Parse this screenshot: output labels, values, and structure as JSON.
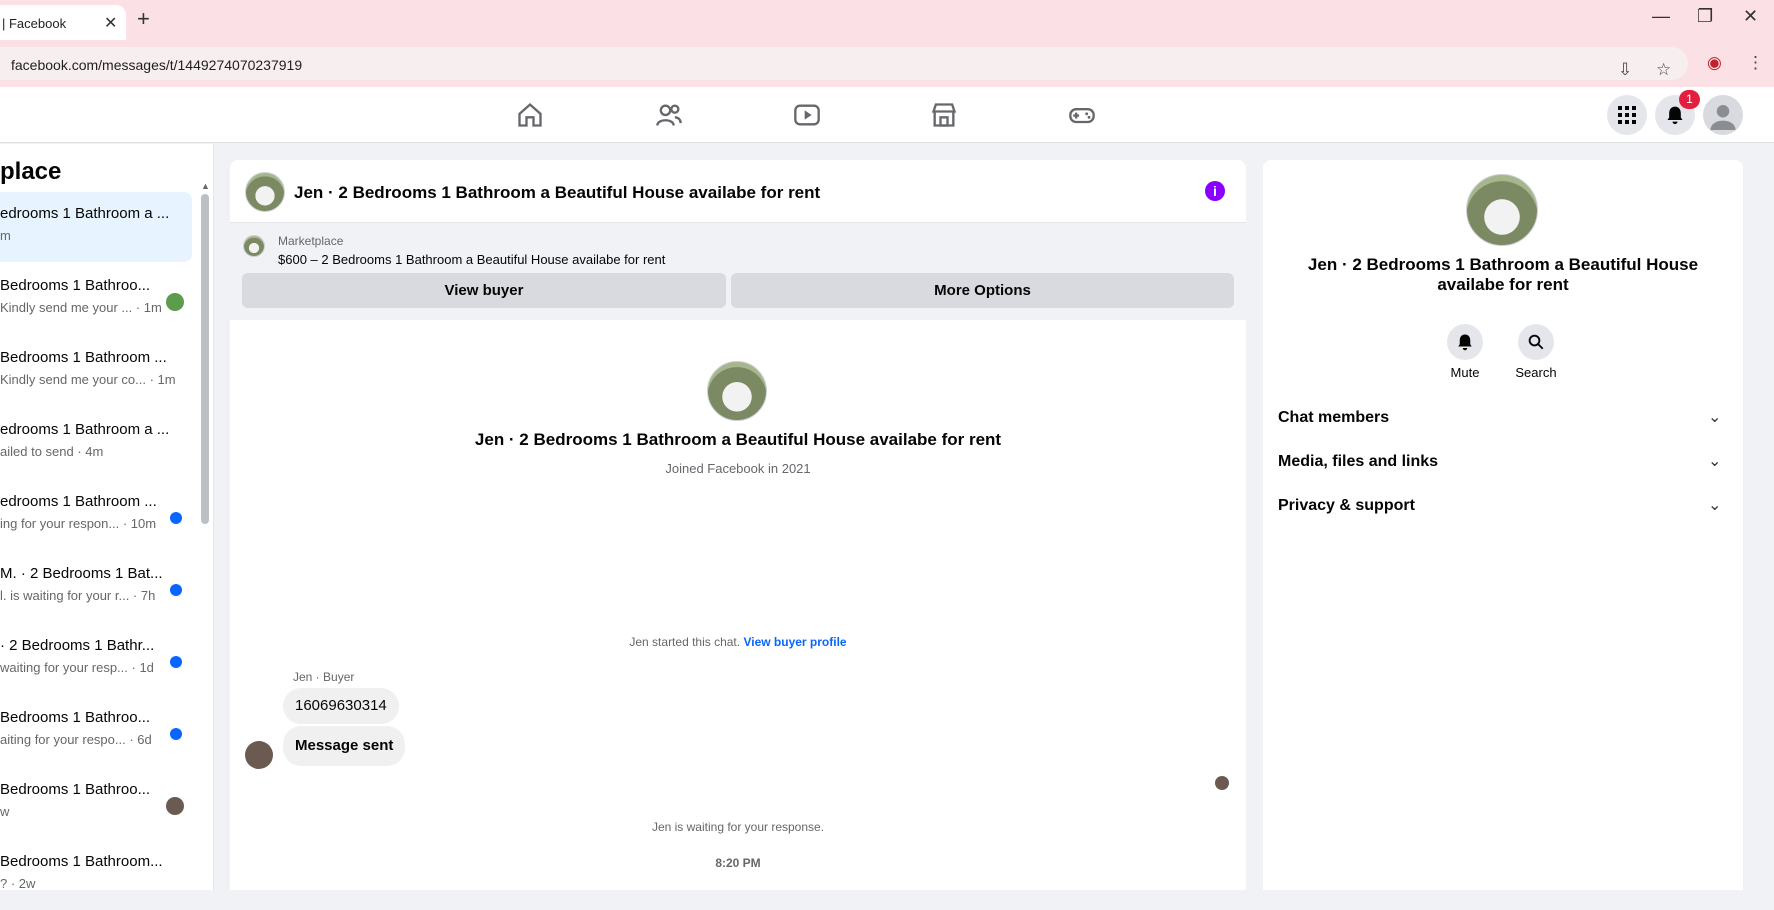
{
  "browser": {
    "tab_title": "| Facebook",
    "tab_close": "✕",
    "new_tab": "+",
    "url": "facebook.com/messages/t/1449274070237919"
  },
  "top_nav": {
    "notification_count": "1"
  },
  "left_panel": {
    "title": "place",
    "conversations": [
      {
        "name": "edrooms 1 Bathroom a ...",
        "sub": "m",
        "active": true
      },
      {
        "name": " Bedrooms 1 Bathroo...",
        "sub": "Kindly send me your ... · 1m"
      },
      {
        "name": " Bedrooms 1 Bathroom ...",
        "sub": "Kindly send me your co... · 1m"
      },
      {
        "name": "edrooms 1 Bathroom a ...",
        "sub": "ailed to send · 4m"
      },
      {
        "name": "edrooms 1 Bathroom ...",
        "sub": "ing for your respon... · 10m"
      },
      {
        "name": "M. · 2 Bedrooms 1 Bat...",
        "sub": "l. is waiting for your r... · 7h"
      },
      {
        "name": "· 2 Bedrooms 1 Bathr...",
        "sub": "waiting for your resp... · 1d"
      },
      {
        "name": "Bedrooms 1 Bathroo...",
        "sub": "aiting for your respo... · 6d"
      },
      {
        "name": "Bedrooms 1 Bathroo...",
        "sub": "w"
      },
      {
        "name": " Bedrooms 1 Bathroom...",
        "sub": "? · 2w"
      }
    ]
  },
  "chat": {
    "title": "Jen · 2 Bedrooms 1 Bathroom a Beautiful House availabe for rent",
    "info_icon": "i",
    "marketplace_label": "Marketplace",
    "marketplace_listing": "$600 – 2 Bedrooms 1 Bathroom a Beautiful House availabe for rent",
    "view_buyer_label": "View buyer",
    "more_options_label": "More Options",
    "profile_name": "Jen · 2 Bedrooms 1 Bathroom a Beautiful House availabe for rent",
    "profile_joined": "Joined Facebook in 2021",
    "started_text": "Jen started this chat.",
    "view_profile_link": "View buyer profile",
    "sender_label": "Jen · Buyer",
    "messages": [
      "16069630314",
      "Message sent"
    ],
    "waiting_text": "Jen is waiting for your response.",
    "time": "8:20 PM"
  },
  "right_panel": {
    "name": "Jen · 2 Bedrooms 1 Bathroom a Beautiful House availabe for rent",
    "mute_label": "Mute",
    "search_label": "Search",
    "sections": [
      "Chat members",
      "Media, files and links",
      "Privacy & support"
    ]
  },
  "icons": {
    "home": "home-icon",
    "friends": "friends-icon",
    "watch": "watch-icon",
    "marketplace": "marketplace-icon",
    "gaming": "gaming-icon"
  },
  "colors": {
    "accent_blue": "#0866ff",
    "info_purple": "#8a00ff",
    "badge_red": "#e41e3f",
    "chrome_pink": "#fbe1e6"
  }
}
